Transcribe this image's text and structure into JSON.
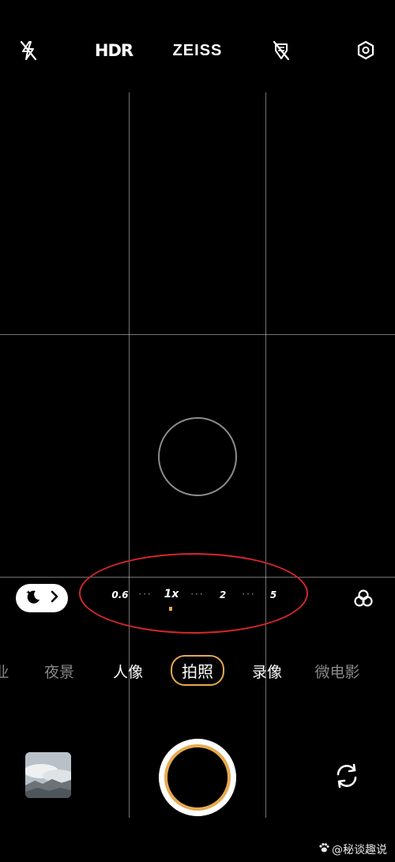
{
  "top_bar": {
    "flash_icon": "flash-off-icon",
    "hdr_label": "HDR",
    "brand_label": "ZEISS",
    "ai_icon": "ai-off-icon",
    "settings_icon": "settings-icon"
  },
  "viewfinder": {
    "grid": "3x3",
    "focus_icon": "focus-ring"
  },
  "night_toggle": {
    "icon": "moon-icon",
    "chevron": "chevron-right-icon"
  },
  "zoom": {
    "levels": [
      "0.6",
      "1x",
      "2",
      "5"
    ],
    "selected": "1x",
    "separator": "···",
    "highlight_color": "#d7262d",
    "marker_color": "#e7a94f"
  },
  "filter_icon": "filters-icon",
  "modes": {
    "items": [
      "业",
      "夜景",
      "人像",
      "拍照",
      "录像",
      "微电影"
    ],
    "selected": "拍照",
    "accent_color": "#e7a94f"
  },
  "bottom": {
    "gallery_icon": "gallery-thumbnail",
    "shutter_icon": "shutter-button",
    "switch_icon": "switch-camera-icon"
  },
  "watermark": {
    "text": "@秘谈趣说",
    "icon": "paw-icon"
  }
}
